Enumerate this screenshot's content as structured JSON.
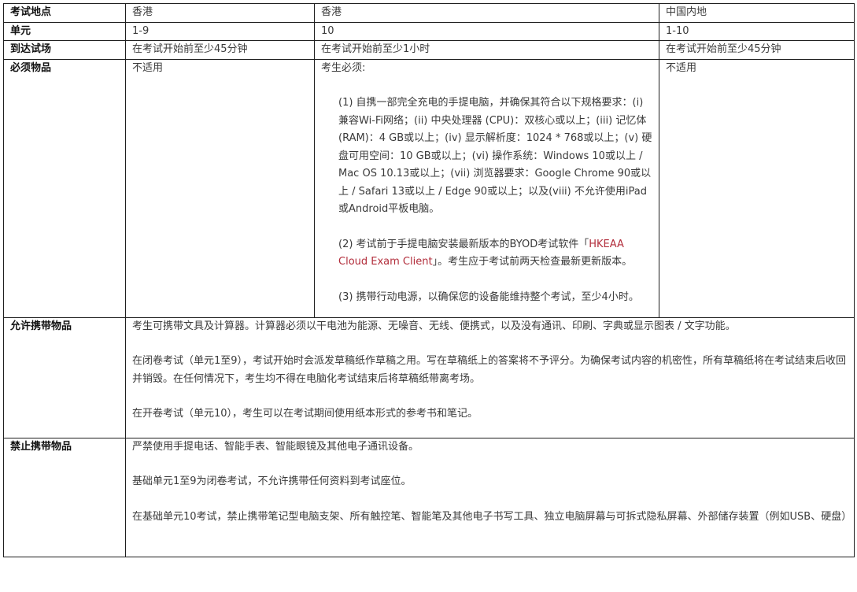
{
  "rows": {
    "venue": {
      "label": "考试地点",
      "col1": "香港",
      "col2": "香港",
      "col3": "中国内地"
    },
    "unit": {
      "label": "单元",
      "col1": "1-9",
      "col2": "10",
      "col3": "1-10"
    },
    "arrival": {
      "label": "到达试场",
      "col1": "在考试开始前至少45分钟",
      "col2": "在考试开始前至少1小时",
      "col3": "在考试开始前至少45分钟"
    },
    "required": {
      "label": "必须物品",
      "col1": "不适用",
      "col2_intro": "考生必须:",
      "col2_item1": "(1) 自携一部完全充电的手提电脑，并确保其符合以下规格要求：(i) 兼容Wi-Fi网络；(ii) 中央处理器 (CPU)：双核心或以上；(iii) 记忆体 (RAM)：4 GB或以上；(iv) 显示解析度：1024 * 768或以上；(v) 硬盘可用空间：10 GB或以上；(vi) 操作系统：Windows 10或以上 / Mac OS 10.13或以上；(vii) 浏览器要求：Google Chrome 90或以上 / Safari 13或以上 / Edge 90或以上；以及(viii) 不允许使用iPad或Android平板电脑。",
      "col2_item2_before": "(2) 考试前于手提电脑安装最新版本的BYOD考试软件「",
      "col2_item2_link": "HKEAA Cloud Exam Client",
      "col2_item2_after": "」。考生应于考试前两天检查最新更新版本。",
      "col2_item3": "(3) 携带行动电源，以确保您的设备能维持整个考试，至少4小时。",
      "col3": "不适用"
    },
    "allowed": {
      "label": "允许携带物品",
      "p1": "考生可携带文具及计算器。计算器必须以干电池为能源、无噪音、无线、便携式，以及没有通讯、印刷、字典或显示图表 / 文字功能。",
      "p2": "在闭卷考试（单元1至9），考试开始时会派发草稿纸作草稿之用。写在草稿纸上的答案将不予评分。为确保考试内容的机密性，所有草稿纸将在考试结束后收回并销毁。在任何情况下，考生均不得在电脑化考试结束后将草稿纸带离考场。",
      "p3": "在开卷考试（单元10），考生可以在考试期间使用纸本形式的参考书和笔记。"
    },
    "banned": {
      "label": "禁止携带物品",
      "p1": "严禁使用手提电话、智能手表、智能眼镜及其他电子通讯设备。",
      "p2": "基础单元1至9为闭卷考试，不允许携带任何资料到考试座位。",
      "p3": "在基础单元10考试，禁止携带笔记型电脑支架、所有触控笔、智能笔及其他电子书写工具、独立电脑屏幕与可拆式隐私屏幕、外部储存装置（例如USB、硬盘）"
    }
  },
  "colors": {
    "link": "#b22d3b",
    "border": "#1f1f1f",
    "text": "#3a3a3a"
  }
}
